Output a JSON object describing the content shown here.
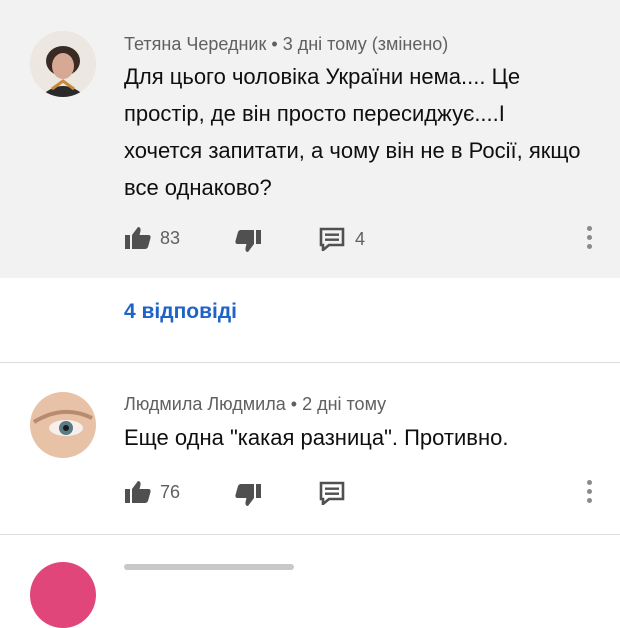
{
  "comments": [
    {
      "author": "Тетяна Чередник",
      "time": "3 дні тому (змінено)",
      "text": "Для цього чоловіка України нема.... Це простір, де він просто  пересиджує....І хочется запитати, а чому він не в Росії, якщо все однаково?",
      "likes": "83",
      "replies_count": "4"
    },
    {
      "author": "Людмила Людмила",
      "time": "2 дні тому",
      "text": "Еще одна \"какая разница\". Противно.",
      "likes": "76"
    }
  ],
  "replies_link": "4 відповіді",
  "icons": [
    "thumbs-up-icon",
    "thumbs-down-icon",
    "comment-reply-icon",
    "more-vertical-icon"
  ],
  "colors": {
    "link": "#1e63c7",
    "meta": "#606060",
    "highlight_bg": "#f2f2f2"
  }
}
